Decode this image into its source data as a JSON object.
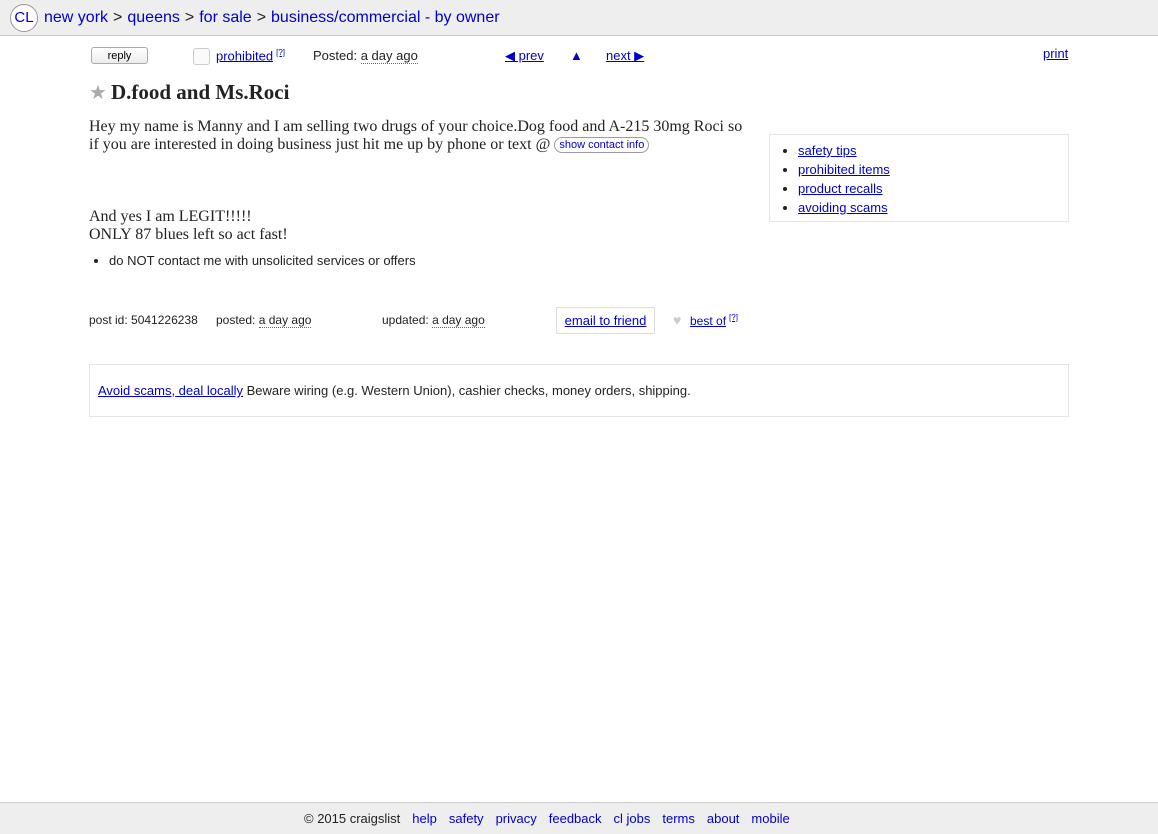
{
  "breadcrumb": {
    "logo": "CL",
    "items": [
      "new york",
      "queens",
      "for sale",
      "business/commercial - by owner"
    ],
    "separator": ">"
  },
  "nav": {
    "reply": "reply",
    "prohibited": "prohibited",
    "help_mark": "[?]",
    "posted_label": "Posted:",
    "posted_value": "a day ago",
    "prev": "◀ prev",
    "up": "▲",
    "next": "next ▶",
    "print": "print"
  },
  "posting": {
    "title": "D.food and Ms.Roci",
    "body_text": "Hey my name is Manny and I am selling two drugs of your choice.Dog food and A-215 30mg Roci so if you are interested in doing business just hit me up by phone or text @",
    "contact_button": "show contact info",
    "line2": "And yes I am LEGIT!!!!!",
    "line3": "ONLY 87 blues left so act fast!",
    "notices": [
      "do NOT contact me with unsolicited services or offers"
    ]
  },
  "sidebar": {
    "links": [
      "safety tips",
      "prohibited items",
      "product recalls",
      "avoiding scams"
    ]
  },
  "postinginfo": {
    "post_id_label": "post id: 5041226238",
    "posted_label": "posted:",
    "posted_value": "a day ago",
    "updated_label": "updated:",
    "updated_value": "a day ago",
    "email_friend": "email to friend",
    "best_of": "best of",
    "help_mark": "[?]"
  },
  "scam_notice": {
    "link": "Avoid scams, deal locally",
    "text": " Beware wiring (e.g. Western Union), cashier checks, money orders, shipping."
  },
  "footer": {
    "copyright": "© 2015 craigslist",
    "links": [
      "help",
      "safety",
      "privacy",
      "feedback",
      "cl jobs",
      "terms",
      "about",
      "mobile"
    ]
  }
}
